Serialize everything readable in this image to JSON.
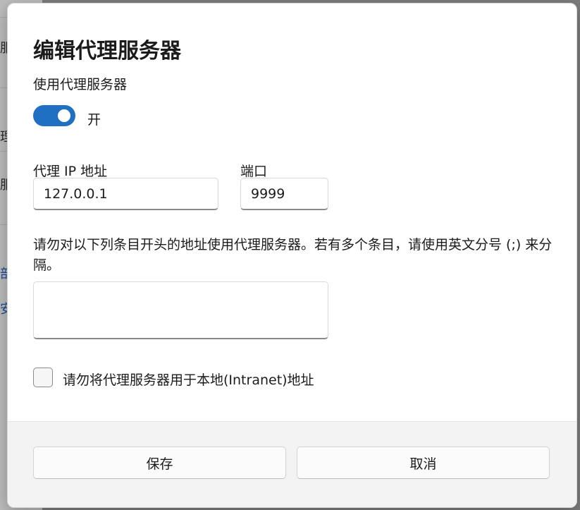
{
  "background": {
    "fragments": [
      "服",
      "理",
      "服",
      "部",
      "安"
    ]
  },
  "dialog": {
    "title": "编辑代理服务器",
    "use_proxy_label": "使用代理服务器",
    "toggle_state": "开",
    "toggle_on": true,
    "ip_label": "代理 IP 地址",
    "ip_value": "127.0.0.1",
    "port_label": "端口",
    "port_value": "9999",
    "exceptions_note": "请勿对以下列条目开头的地址使用代理服务器。若有多个条目，请使用英文分号 (;) 来分隔。",
    "exceptions_value": "",
    "bypass_local_label": "请勿将代理服务器用于本地(Intranet)地址",
    "bypass_local_checked": false,
    "save_label": "保存",
    "cancel_label": "取消"
  },
  "colors": {
    "accent": "#1f6fc2"
  }
}
